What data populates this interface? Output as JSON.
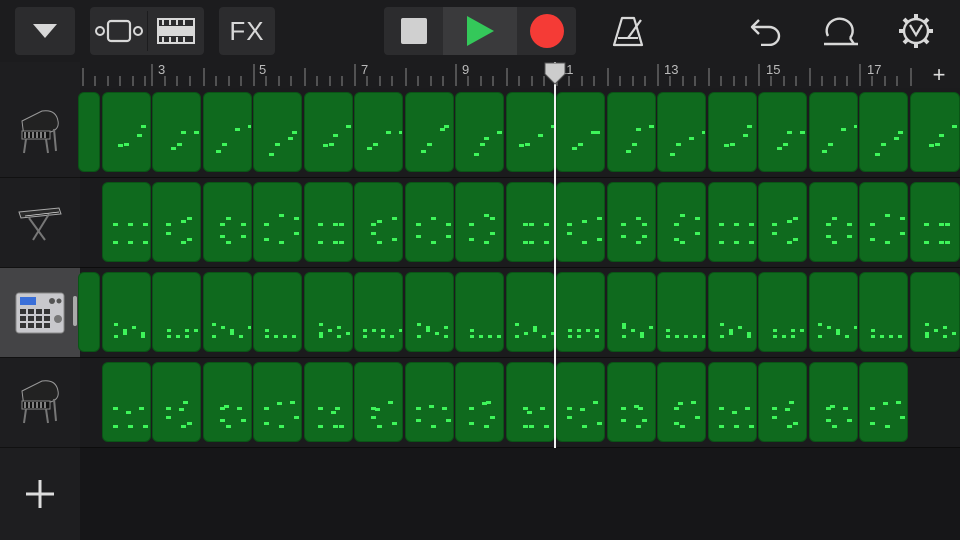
{
  "toolbar": {
    "fx_label": "FX"
  },
  "ruler": {
    "bar_numbers": [
      "3",
      "5",
      "7",
      "9",
      "11",
      "13",
      "15",
      "17"
    ],
    "add_label": "+"
  },
  "tracks": [
    {
      "instrument_icon": "grand-piano-icon"
    },
    {
      "instrument_icon": "keyboard-synth-icon"
    },
    {
      "instrument_icon": "drum-machine-icon",
      "selected": true
    },
    {
      "instrument_icon": "grand-piano-icon"
    }
  ],
  "add_track_label": "+",
  "colors": {
    "region": "#0f6a1e",
    "note": "#3ef55a",
    "record": "#f53b36",
    "play": "#34c85a"
  }
}
